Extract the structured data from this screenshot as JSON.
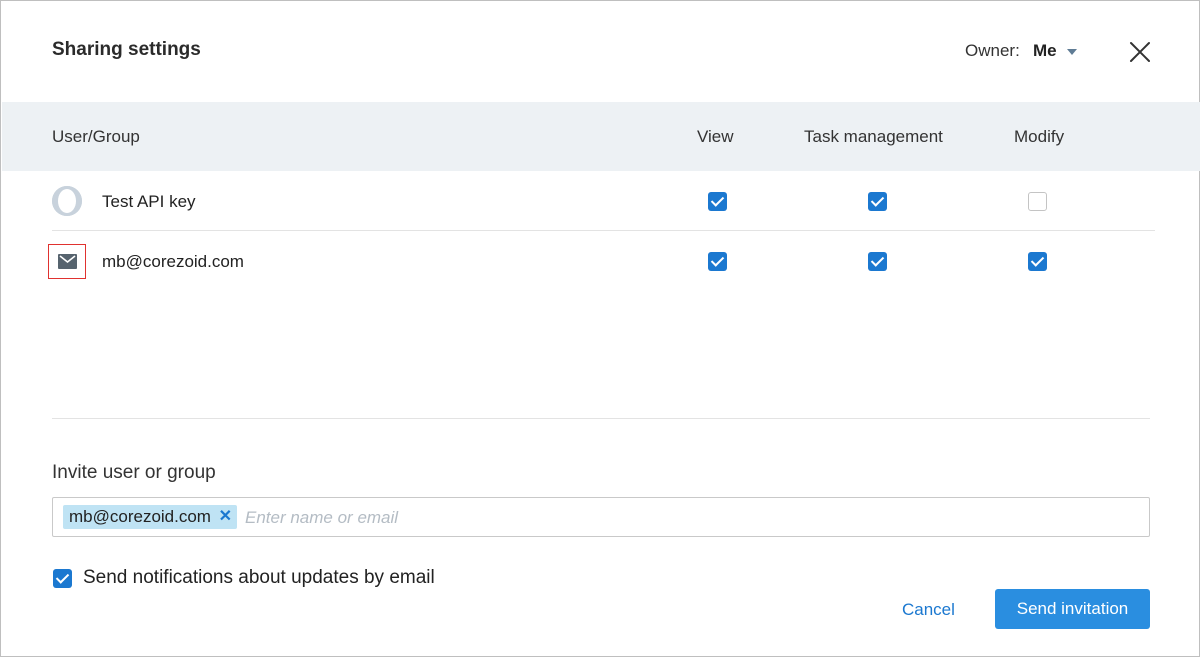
{
  "dialog": {
    "title": "Sharing settings",
    "owner_label": "Owner:",
    "owner_value": "Me"
  },
  "table": {
    "headers": {
      "user_group": "User/Group",
      "view": "View",
      "task_management": "Task management",
      "modify": "Modify"
    },
    "rows": [
      {
        "name": "Test API key",
        "icon": "user-avatar-icon",
        "view": true,
        "task_management": true,
        "modify": false
      },
      {
        "name": "mb@corezoid.com",
        "icon": "envelope-icon",
        "view": true,
        "task_management": true,
        "modify": true
      }
    ]
  },
  "invite": {
    "label": "Invite user or group",
    "chips": [
      "mb@corezoid.com"
    ],
    "placeholder": "Enter name or email",
    "value": ""
  },
  "notifications": {
    "checked": true,
    "label": "Send notifications about updates by email"
  },
  "actions": {
    "cancel_label": "Cancel",
    "send_label": "Send invitation"
  },
  "colors": {
    "accent": "#1b78d0",
    "primary_button": "#2a8ee0",
    "header_band": "#edf1f4",
    "chip_background": "#bfe3f4",
    "highlight_border": "#e0322f"
  }
}
